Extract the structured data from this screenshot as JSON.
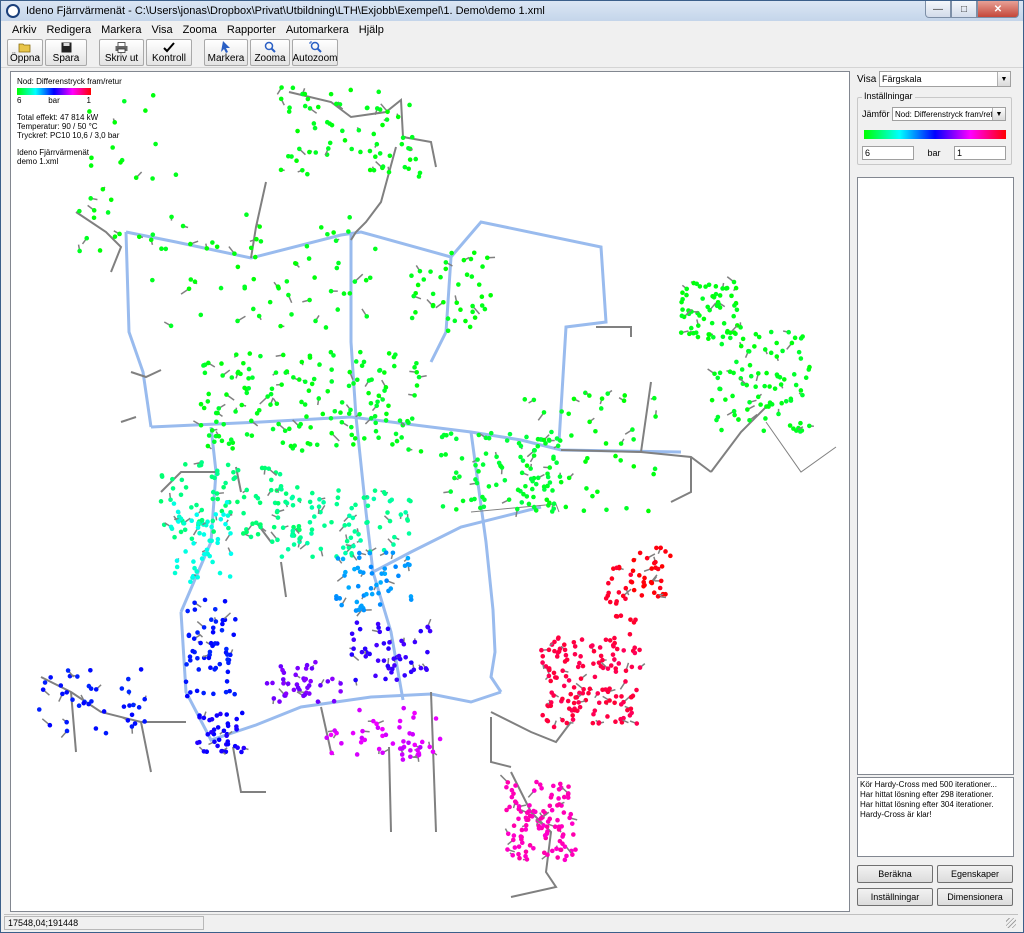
{
  "window": {
    "title": "Ideno Fjärrvärmenät - C:\\Users\\jonas\\Dropbox\\Privat\\Utbildning\\LTH\\Exjobb\\Exempel\\1. Demo\\demo 1.xml",
    "minimize": "—",
    "maximize": "□",
    "close": "✕"
  },
  "menu": [
    "Arkiv",
    "Redigera",
    "Markera",
    "Visa",
    "Zooma",
    "Rapporter",
    "Automarkera",
    "Hjälp"
  ],
  "toolbar": {
    "open": "Öppna",
    "save": "Spara",
    "print": "Skriv ut",
    "check": "Kontroll",
    "select": "Markera",
    "zoom": "Zooma",
    "autozoom": "Autozoom"
  },
  "legend": {
    "title": "Nod: Differenstryck fram/retur",
    "min": "6",
    "unit": "bar",
    "max": "1",
    "total_power": "Total effekt: 47 814 kW",
    "temperature": "Temperatur: 90 / 50 °C",
    "pressure_ref": "Tryckref: PC10 10,6 / 3,0 bar",
    "app_name": "Ideno Fjärrvärmenät",
    "file_name": "demo 1.xml"
  },
  "panel": {
    "visa_label": "Visa",
    "visa_value": "Färgskala",
    "settings_title": "Inställningar",
    "compare_label": "Jämför",
    "compare_value": "Nod: Differenstryck fram/retur",
    "min_value": "6",
    "unit": "bar",
    "max_value": "1"
  },
  "log": [
    "Kör Hardy-Cross med 500 iterationer...",
    "Har hittat lösning efter 298 iterationer.",
    "Har hittat lösning efter 304 iterationer.",
    "Hardy-Cross är klar!"
  ],
  "buttons": {
    "calculate": "Beräkna",
    "properties": "Egenskaper",
    "settings": "Inställningar",
    "dimension": "Dimensionera"
  },
  "status": {
    "coordinates": "17548,04;191448"
  },
  "colors": {
    "main_pipe": "#99bbee",
    "branch_pipe": "#808080",
    "scale": [
      "#00ff00",
      "#00ffff",
      "#0000ff",
      "#ff00ff",
      "#ff0000"
    ]
  }
}
